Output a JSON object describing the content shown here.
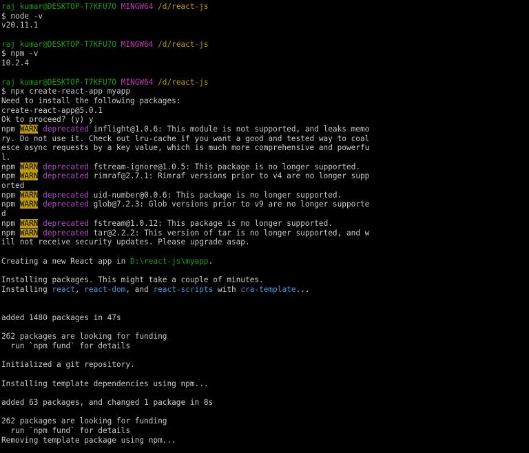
{
  "prompt": {
    "user_host": "raj kumar@DESKTOP-T7KFU7O",
    "shell": "MINGW64",
    "cwd": "/d/react-js"
  },
  "lines": [
    {
      "type": "prompt"
    },
    {
      "type": "text",
      "text": "$ node -v"
    },
    {
      "type": "text",
      "text": "v20.11.1"
    },
    {
      "type": "blank"
    },
    {
      "type": "prompt"
    },
    {
      "type": "text",
      "text": "$ npm -v"
    },
    {
      "type": "text",
      "text": "10.2.4"
    },
    {
      "type": "blank"
    },
    {
      "type": "prompt"
    },
    {
      "type": "text",
      "text": "$ npx create-react-app myapp"
    },
    {
      "type": "text",
      "text": "Need to install the following packages:"
    },
    {
      "type": "text",
      "text": "create-react-app@5.0.1"
    },
    {
      "type": "text",
      "text": "Ok to proceed? (y) y"
    },
    {
      "type": "warn",
      "text": " inflight@1.0.6: This module is not supported, and leaks memo"
    },
    {
      "type": "text",
      "text": "ry. Do not use it. Check out lru-cache if you want a good and tested way to coal"
    },
    {
      "type": "text",
      "text": "esce async requests by a key value, which is much more comprehensive and powerfu"
    },
    {
      "type": "text",
      "text": "l."
    },
    {
      "type": "warn",
      "text": " fstream-ignore@1.0.5: This package is no longer supported."
    },
    {
      "type": "warn",
      "text": " rimraf@2.7.1: Rimraf versions prior to v4 are no longer supp"
    },
    {
      "type": "text",
      "text": "orted"
    },
    {
      "type": "warn",
      "text": " uid-number@0.0.6: This package is no longer supported."
    },
    {
      "type": "warn",
      "text": " glob@7.2.3: Glob versions prior to v9 are no longer supporte"
    },
    {
      "type": "text",
      "text": "d"
    },
    {
      "type": "warn",
      "text": " fstream@1.0.12: This package is no longer supported."
    },
    {
      "type": "warn",
      "text": " tar@2.2.2: This version of tar is no longer supported, and w"
    },
    {
      "type": "text",
      "text": "ill not receive security updates. Please upgrade asap."
    },
    {
      "type": "blank"
    },
    {
      "type": "segments",
      "parts": [
        {
          "t": "Creating a new React app in "
        },
        {
          "t": "D:\\react-js\\myapp",
          "c": "green"
        },
        {
          "t": "."
        }
      ]
    },
    {
      "type": "blank"
    },
    {
      "type": "text",
      "text": "Installing packages. This might take a couple of minutes."
    },
    {
      "type": "segments",
      "parts": [
        {
          "t": "Installing "
        },
        {
          "t": "react",
          "c": "cyan"
        },
        {
          "t": ", "
        },
        {
          "t": "react-dom",
          "c": "cyan"
        },
        {
          "t": ", and "
        },
        {
          "t": "react-scripts",
          "c": "cyan"
        },
        {
          "t": " with "
        },
        {
          "t": "cra-template",
          "c": "cyan"
        },
        {
          "t": "..."
        }
      ]
    },
    {
      "type": "blank"
    },
    {
      "type": "blank"
    },
    {
      "type": "text",
      "text": "added 1480 packages in 47s"
    },
    {
      "type": "blank"
    },
    {
      "type": "text",
      "text": "262 packages are looking for funding"
    },
    {
      "type": "text",
      "text": "  run `npm fund` for details"
    },
    {
      "type": "blank"
    },
    {
      "type": "text",
      "text": "Initialized a git repository."
    },
    {
      "type": "blank"
    },
    {
      "type": "text",
      "text": "Installing template dependencies using npm..."
    },
    {
      "type": "blank"
    },
    {
      "type": "text",
      "text": "added 63 packages, and changed 1 package in 8s"
    },
    {
      "type": "blank"
    },
    {
      "type": "text",
      "text": "262 packages are looking for funding"
    },
    {
      "type": "text",
      "text": "  run `npm fund` for details"
    },
    {
      "type": "text",
      "text": "Removing template package using npm..."
    }
  ],
  "warn_label": "WARN",
  "npm_label": "npm",
  "deprecated_label": "deprecated"
}
